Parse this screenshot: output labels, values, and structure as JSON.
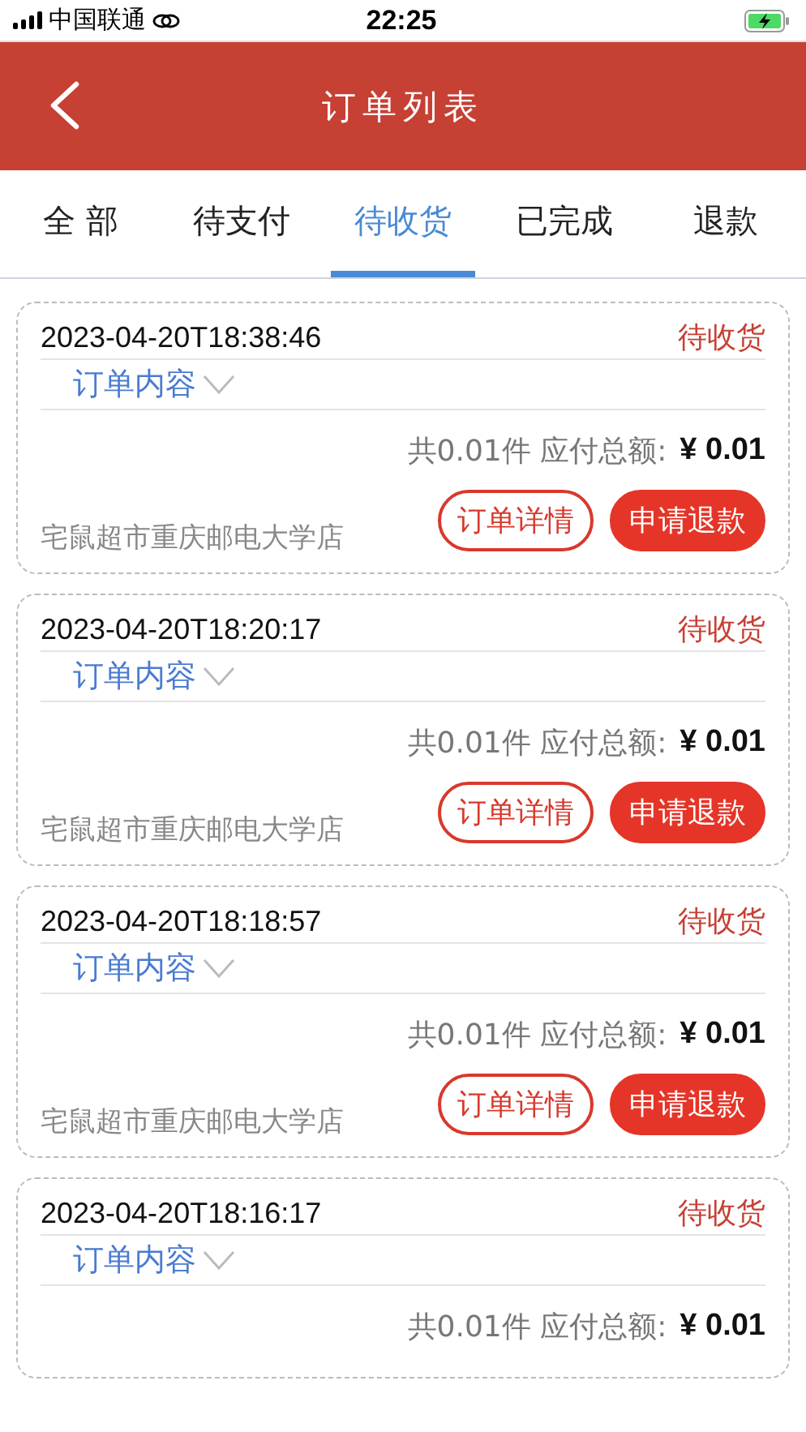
{
  "status_bar": {
    "carrier": "中国联通",
    "time": "22:25"
  },
  "header": {
    "title": "订单列表"
  },
  "tabs": [
    {
      "label": "全 部",
      "selected": false
    },
    {
      "label": "待支付",
      "selected": false
    },
    {
      "label": "待收货",
      "selected": true
    },
    {
      "label": "已完成",
      "selected": false
    },
    {
      "label": "退款",
      "selected": false
    }
  ],
  "orders": [
    {
      "time": "2023-04-20T18:38:46",
      "status": "待收货",
      "content_label": "订单内容",
      "summary": "共0.01件 应付总额:",
      "amount": "¥ 0.01",
      "store": "宅鼠超市重庆邮电大学店",
      "buttons": [
        {
          "label": "订单详情",
          "kind": "outline"
        },
        {
          "label": "申请退款",
          "kind": "filled"
        }
      ]
    },
    {
      "time": "2023-04-20T18:20:17",
      "status": "待收货",
      "content_label": "订单内容",
      "summary": "共0.01件 应付总额:",
      "amount": "¥ 0.01",
      "store": "宅鼠超市重庆邮电大学店",
      "buttons": [
        {
          "label": "订单详情",
          "kind": "outline"
        },
        {
          "label": "申请退款",
          "kind": "filled"
        }
      ]
    },
    {
      "time": "2023-04-20T18:18:57",
      "status": "待收货",
      "content_label": "订单内容",
      "summary": "共0.01件 应付总额:",
      "amount": "¥ 0.01",
      "store": "宅鼠超市重庆邮电大学店",
      "buttons": [
        {
          "label": "订单详情",
          "kind": "outline"
        },
        {
          "label": "申请退款",
          "kind": "filled"
        }
      ]
    },
    {
      "time": "2023-04-20T18:16:17",
      "status": "待收货",
      "content_label": "订单内容",
      "summary": "共0.01件 应付总额:",
      "amount": "¥ 0.01"
    }
  ]
}
